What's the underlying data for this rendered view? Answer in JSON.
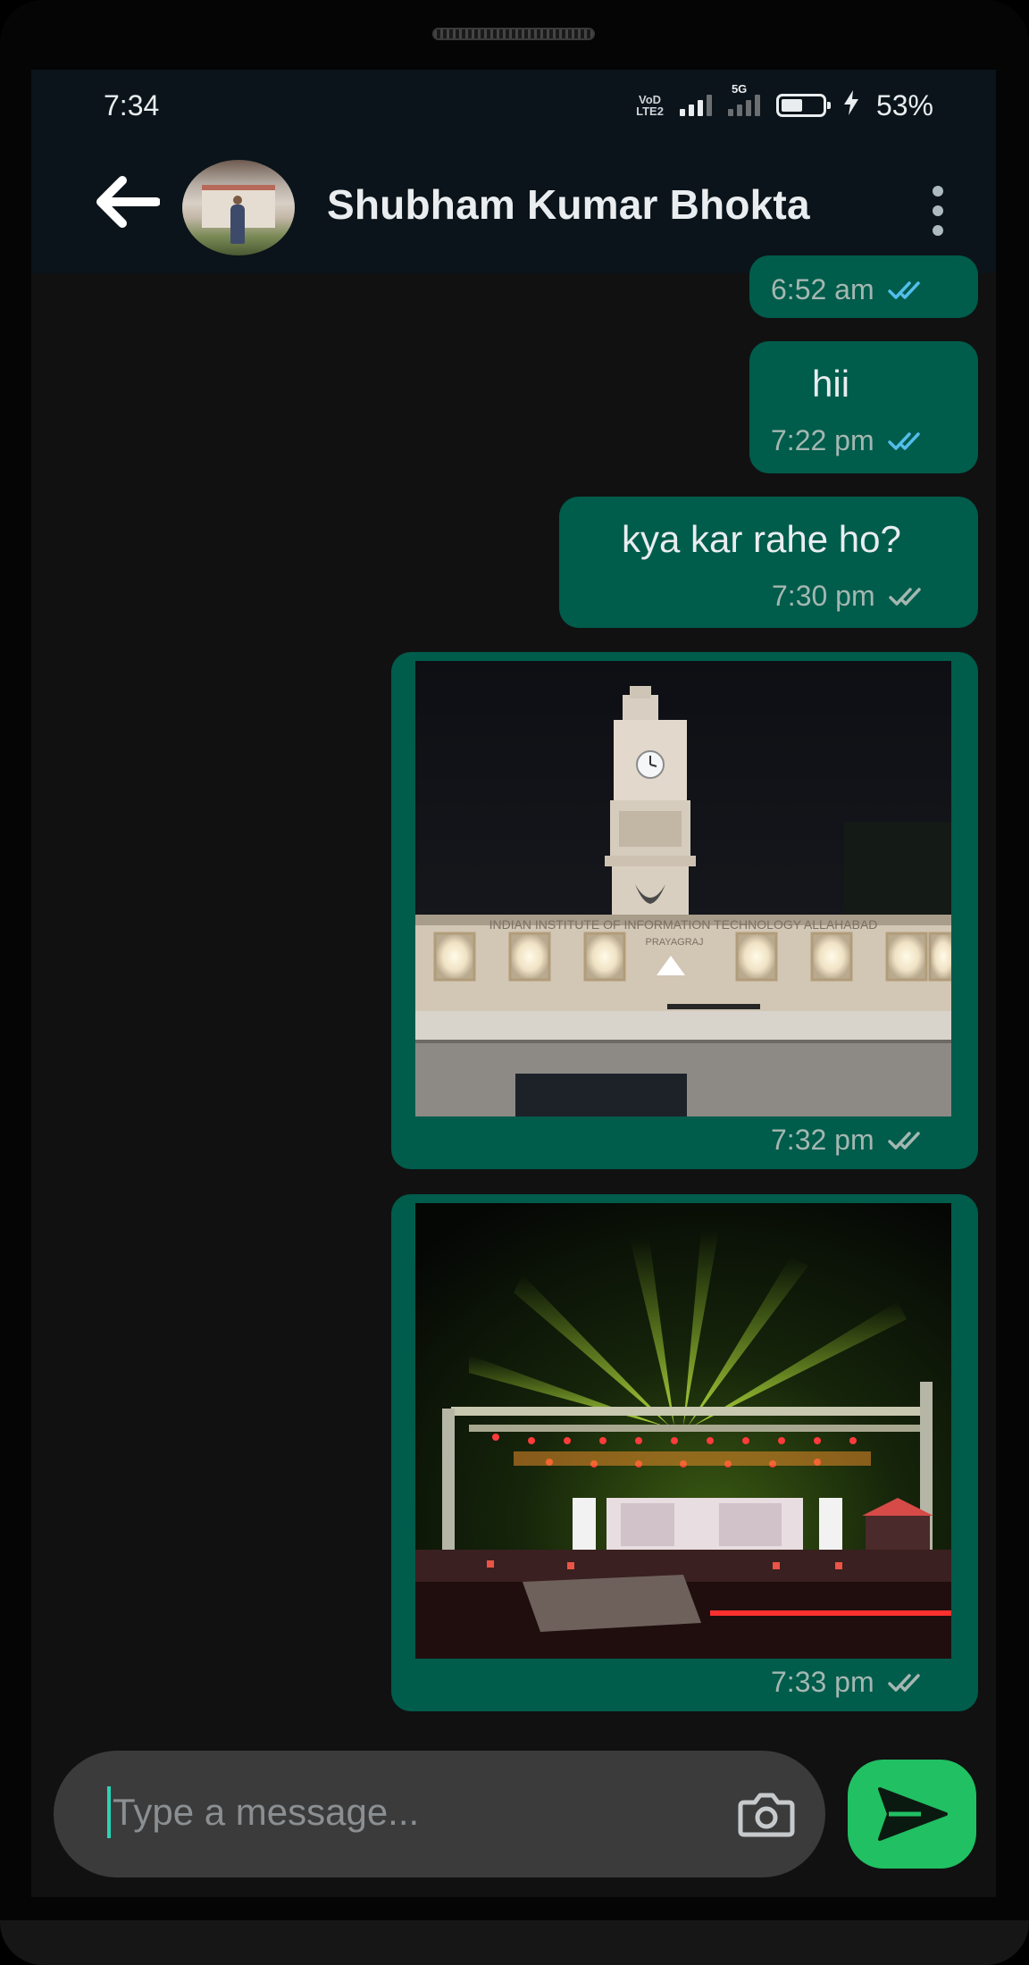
{
  "status_bar": {
    "time": "7:34",
    "network_label_top": "VoD",
    "network_label_bottom": "LTE2",
    "network_5g": "5G",
    "battery_percent": "53%",
    "battery_level": 0.53
  },
  "header": {
    "contact_name": "Shubham Kumar Bhokta"
  },
  "messages": [
    {
      "type": "text",
      "text": "",
      "time": "6:52 am",
      "status": "read"
    },
    {
      "type": "text",
      "text": "hii",
      "time": "7:22 pm",
      "status": "read"
    },
    {
      "type": "text",
      "text": "kya kar rahe ho?",
      "time": "7:30 pm",
      "status": "delivered"
    },
    {
      "type": "image",
      "caption": "",
      "time": "7:32 pm",
      "status": "delivered",
      "banner_text": "INDIAN INSTITUTE OF INFORMATION TECHNOLOGY ALLAHABAD",
      "sub_text": "PRAYAGRAJ"
    },
    {
      "type": "image",
      "caption": "",
      "time": "7:33 pm",
      "status": "delivered"
    }
  ],
  "composer": {
    "placeholder": "Type a message..."
  },
  "colors": {
    "header_bg": "#0b141a",
    "chat_bg": "#111111",
    "outgoing_bubble": "#005c4b",
    "read_tick": "#53bdeb",
    "delivered_tick": "#a4b7b1",
    "send_button": "#21c063",
    "composer_bg": "#3b3b3b"
  },
  "icons": {
    "back": "arrow-left-icon",
    "menu": "more-vert-icon",
    "camera": "camera-icon",
    "send": "send-icon"
  }
}
